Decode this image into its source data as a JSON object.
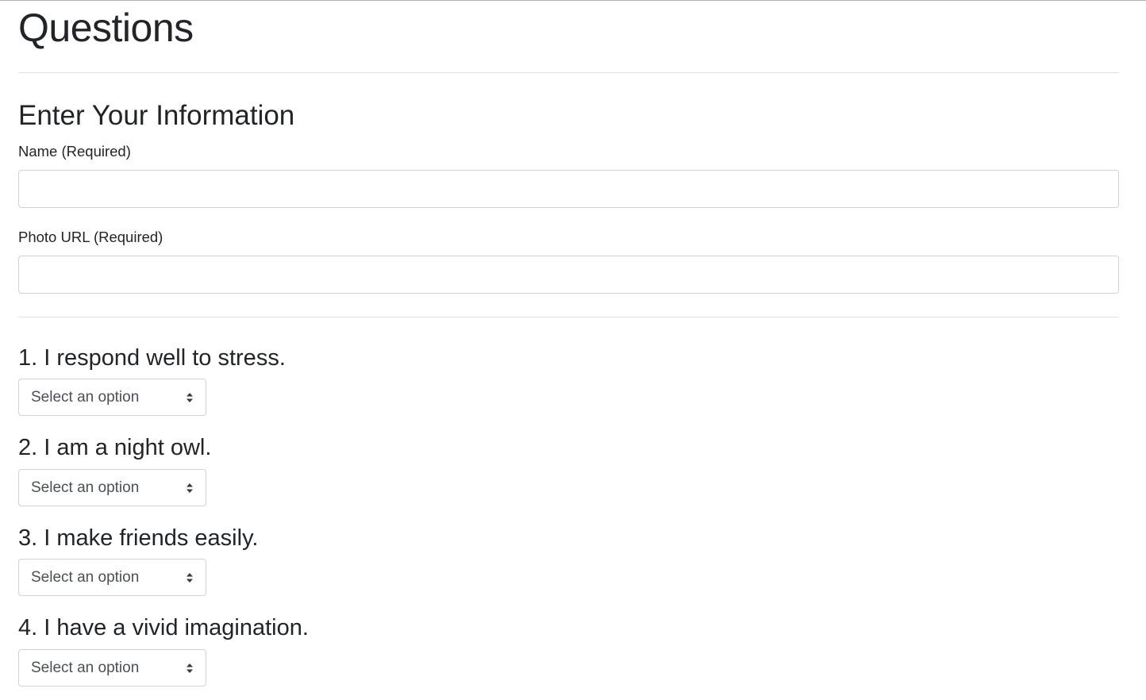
{
  "page": {
    "title": "Questions"
  },
  "info_section": {
    "heading": "Enter Your Information",
    "fields": [
      {
        "label": "Name (Required)",
        "value": ""
      },
      {
        "label": "Photo URL (Required)",
        "value": ""
      }
    ]
  },
  "questions": [
    {
      "text": "1. I respond well to stress.",
      "selected": "Select an option"
    },
    {
      "text": "2. I am a night owl.",
      "selected": "Select an option"
    },
    {
      "text": "3. I make friends easily.",
      "selected": "Select an option"
    },
    {
      "text": "4. I have a vivid imagination.",
      "selected": "Select an option"
    }
  ],
  "icons": {
    "select_arrow": "sort-arrows-icon"
  },
  "colors": {
    "text": "#212529",
    "input_border": "#ced4da",
    "divider": "#e3e3e3"
  }
}
